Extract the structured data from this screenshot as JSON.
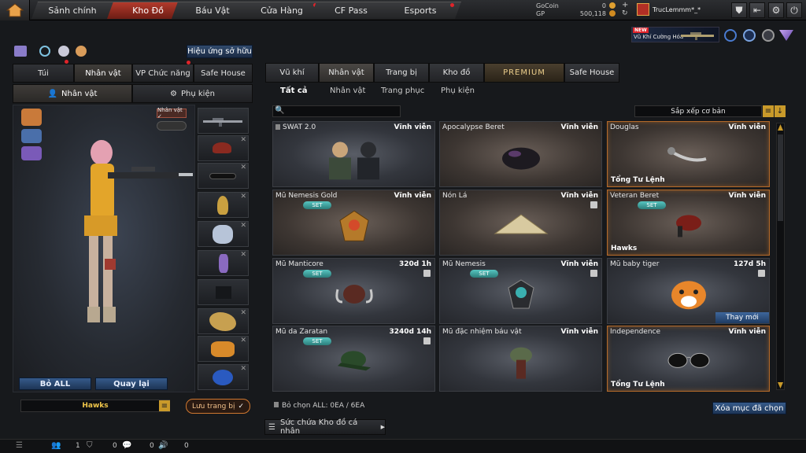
{
  "nav": {
    "tabs": [
      {
        "label": "Sảnh chính"
      },
      {
        "label": "Kho Đồ"
      },
      {
        "label": "Báu Vật"
      },
      {
        "label": "Cửa Hàng"
      },
      {
        "label": "CF Pass"
      },
      {
        "label": "Esports"
      }
    ],
    "active_index": 1,
    "currency": {
      "gocoin_label": "GoCoin",
      "gocoin_value": "0",
      "gp_label": "GP",
      "gp_value": "500,118"
    },
    "username": "TrucLemmm*_*",
    "new_badge": "NEW",
    "promo_label": "Vũ Khí Cường Hóa"
  },
  "left": {
    "effect_button": "Hiệu ứng sở hữu",
    "tabs": [
      {
        "label": "Túi"
      },
      {
        "label": "Nhân vật"
      },
      {
        "label": "VP Chức năng"
      },
      {
        "label": "Safe House"
      }
    ],
    "subtabs": [
      {
        "label": "Nhân vật"
      },
      {
        "label": "Phụ kiện"
      }
    ],
    "character_badge": "Nhân vật ✓",
    "remove_all": "Bỏ ALL",
    "back": "Quay lại",
    "preset_name": "Hawks",
    "save_label": "Lưu trang bị"
  },
  "right": {
    "tabs": [
      {
        "label": "Vũ khí"
      },
      {
        "label": "Nhân vật"
      },
      {
        "label": "Trang bị"
      },
      {
        "label": "Kho đồ"
      },
      {
        "label": "PREMIUM"
      },
      {
        "label": "Safe House"
      }
    ],
    "subtabs": [
      {
        "label": "Tất cả"
      },
      {
        "label": "Nhân vật"
      },
      {
        "label": "Trang phục"
      },
      {
        "label": "Phụ kiện"
      }
    ],
    "sort_label": "Sắp xếp cơ bản",
    "search_placeholder": "",
    "items": [
      {
        "name": "SWAT 2.0",
        "duration": "Vĩnh viễn",
        "set": "",
        "tag": "",
        "lock": false
      },
      {
        "name": "Apocalypse Beret",
        "duration": "Vĩnh viễn",
        "set": "",
        "tag": "",
        "lock": false
      },
      {
        "name": "Douglas",
        "duration": "Vĩnh viễn",
        "set": "",
        "tag": "Tổng Tư Lệnh",
        "lock": false
      },
      {
        "name": "Mũ Nemesis Gold",
        "duration": "Vĩnh viễn",
        "set": "SET",
        "tag": "",
        "lock": false
      },
      {
        "name": "Nón Lá",
        "duration": "Vĩnh viễn",
        "set": "",
        "tag": "",
        "lock": true
      },
      {
        "name": "Veteran Beret",
        "duration": "Vĩnh viễn",
        "set": "SET",
        "tag": "Hawks",
        "lock": false
      },
      {
        "name": "Mũ Manticore",
        "duration": "320d 1h",
        "set": "SET",
        "tag": "",
        "lock": true
      },
      {
        "name": "Mũ Nemesis",
        "duration": "Vĩnh viễn",
        "set": "SET",
        "tag": "",
        "lock": true
      },
      {
        "name": "Mũ baby tiger",
        "duration": "127d 5h",
        "set": "",
        "tag": "",
        "lock": true,
        "action": "Thay mới"
      },
      {
        "name": "Mũ da Zaratan",
        "duration": "3240d 14h",
        "set": "SET",
        "tag": "",
        "lock": true
      },
      {
        "name": "Mũ đặc nhiệm báu vật",
        "duration": "Vĩnh viễn",
        "set": "",
        "tag": "",
        "lock": false
      },
      {
        "name": "Independence",
        "duration": "Vĩnh viễn",
        "set": "",
        "tag": "Tổng Tư Lệnh",
        "lock": false
      }
    ],
    "deselect_all": "Bỏ chọn ALL: 0EA / 6EA",
    "clear_selected": "Xóa mục đã chọn",
    "capacity_label": "Sức chứa Kho đồ cá nhân"
  },
  "bottom": {
    "v1": "1",
    "v2": "0",
    "v3": "0",
    "v4": "0"
  },
  "colors": {
    "accent": "#b23a2c",
    "gold_border": "#b46a2a",
    "button_blue": "#365a8a",
    "set_teal": "#57c5c0"
  }
}
